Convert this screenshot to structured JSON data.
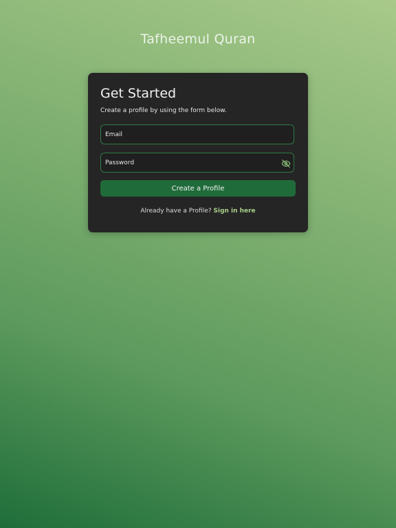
{
  "app": {
    "title": "Tafheemul Quran"
  },
  "card": {
    "title": "Get Started",
    "subtitle": "Create a profile by using the form below.",
    "email_placeholder": "Email",
    "password_placeholder": "Password",
    "password_toggle_icon": "eye-off-icon",
    "submit_label": "Create a Profile",
    "signin_prompt": "Already have a Profile?",
    "signin_link": "Sign in here"
  },
  "colors": {
    "background_top": "#a8c98a",
    "background_bottom": "#1f6e3a",
    "card": "#252525",
    "field_border": "#2f7a45",
    "button": "#206b3a",
    "link": "#a7cf8a"
  }
}
